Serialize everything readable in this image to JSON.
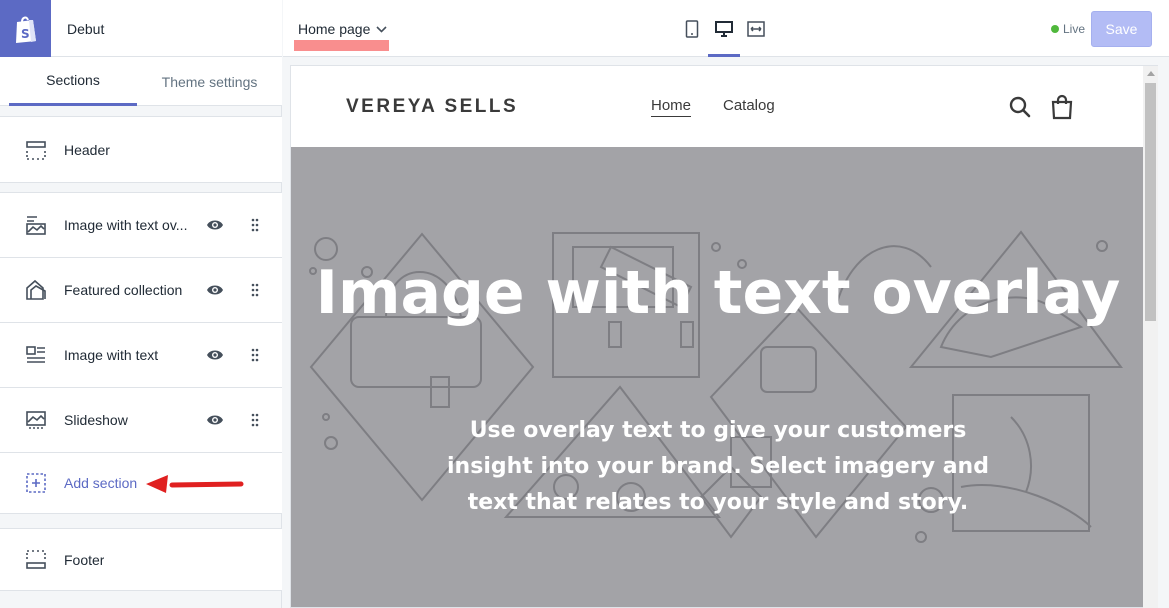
{
  "sidebar": {
    "theme_name": "Debut",
    "tabs": [
      {
        "label": "Sections"
      },
      {
        "label": "Theme settings"
      }
    ],
    "header_item": {
      "label": "Header"
    },
    "sections": [
      {
        "label": "Image with text ov..."
      },
      {
        "label": "Featured collection"
      },
      {
        "label": "Image with text"
      },
      {
        "label": "Slideshow"
      }
    ],
    "add_section": {
      "label": "Add section"
    },
    "footer_item": {
      "label": "Footer"
    }
  },
  "topbar": {
    "page_selector": "Home page",
    "live_label": "Live",
    "save_label": "Save"
  },
  "preview": {
    "store_name": "VEREYA SELLS",
    "nav": [
      {
        "label": "Home"
      },
      {
        "label": "Catalog"
      }
    ],
    "hero": {
      "title": "Image with text overlay",
      "subtitle": "Use overlay text to give your customers insight into your brand. Select imagery and text that relates to your style and story."
    }
  },
  "colors": {
    "accent": "#5c6ac4",
    "save_disabled": "#b3bcf5",
    "live_dot": "#50b83c",
    "hero_bg": "#a3a3a7",
    "annotation_red": "#e02020"
  }
}
